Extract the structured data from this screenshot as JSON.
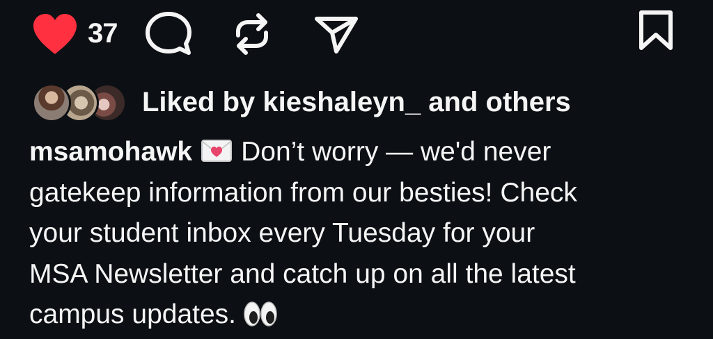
{
  "actions": {
    "like_count": "37",
    "like_icon": "heart-filled-icon",
    "comment_icon": "speech-bubble-icon",
    "repost_icon": "repost-arrows-icon",
    "share_icon": "paper-plane-icon",
    "save_icon": "bookmark-icon",
    "like_color": "#ff3040"
  },
  "liked_by": {
    "text": "Liked by kieshaleyn_ and others"
  },
  "caption": {
    "username": "msamohawk",
    "emoji_start": "love-letter-envelope",
    "lines": [
      "Don’t worry — we'd never",
      "gatekeep information from our besties! Check",
      "your student inbox every Tuesday for your",
      "MSA Newsletter and catch up on all the latest",
      "campus updates."
    ],
    "emoji_end": "eyes"
  }
}
